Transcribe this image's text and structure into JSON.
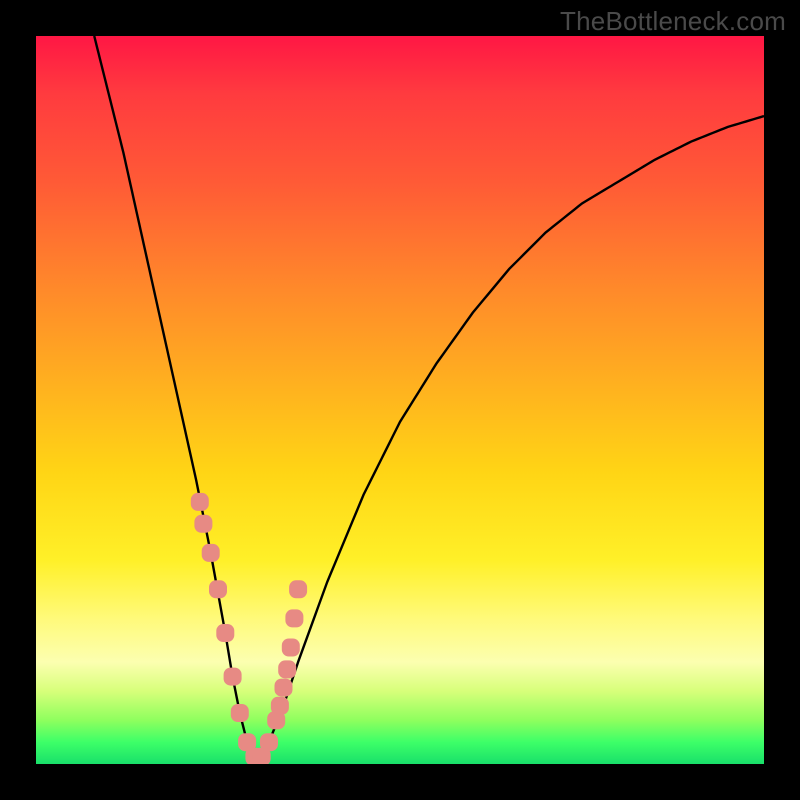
{
  "watermark": "TheBottleneck.com",
  "colors": {
    "curve": "#000000",
    "marker_fill": "#e78a84",
    "marker_stroke": "#d06860"
  },
  "chart_data": {
    "type": "line",
    "title": "",
    "xlabel": "",
    "ylabel": "",
    "xlim": [
      0,
      100
    ],
    "ylim": [
      0,
      100
    ],
    "curve": {
      "name": "bottleneck-curve",
      "x": [
        8,
        10,
        12,
        14,
        16,
        18,
        20,
        22,
        24,
        26,
        27,
        28,
        29,
        30,
        31,
        32,
        34,
        36,
        40,
        45,
        50,
        55,
        60,
        65,
        70,
        75,
        80,
        85,
        90,
        95,
        100
      ],
      "y": [
        100,
        92,
        84,
        75,
        66,
        57,
        48,
        39,
        29,
        18,
        12,
        7,
        3,
        1,
        1,
        3,
        8,
        14,
        25,
        37,
        47,
        55,
        62,
        68,
        73,
        77,
        80,
        83,
        85.5,
        87.5,
        89
      ]
    },
    "markers": {
      "name": "near-optimum-points",
      "x": [
        22.5,
        23.0,
        24.0,
        25.0,
        26.0,
        27.0,
        28.0,
        29.0,
        30.0,
        31.0,
        32.0,
        33.0,
        33.5,
        34.0,
        34.5,
        35.0,
        35.5,
        36.0
      ],
      "y": [
        36.0,
        33.0,
        29.0,
        24.0,
        18.0,
        12.0,
        7.0,
        3.0,
        1.0,
        1.0,
        3.0,
        6.0,
        8.0,
        10.5,
        13.0,
        16.0,
        20.0,
        24.0
      ]
    }
  }
}
